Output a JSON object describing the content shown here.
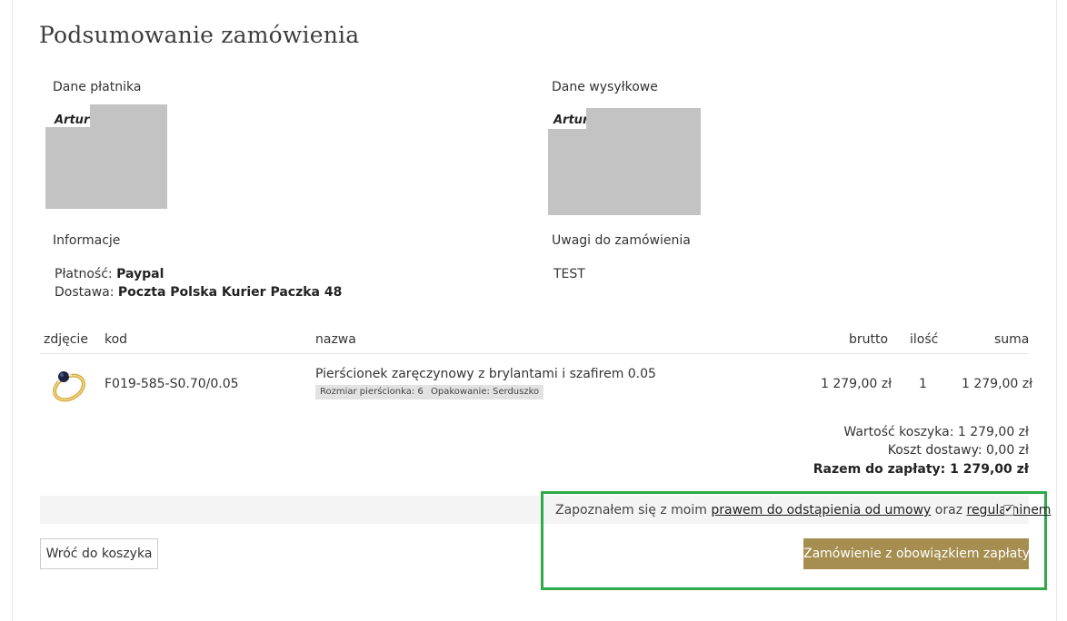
{
  "page": {
    "title": "Podsumowanie zamówienia"
  },
  "payer": {
    "label": "Dane płatnika",
    "name": "Artur"
  },
  "shipping": {
    "label": "Dane wysyłkowe",
    "name": "Artur"
  },
  "information": {
    "label": "Informacje",
    "payment_label": "Płatność:",
    "payment_value": "Paypal",
    "delivery_label": "Dostawa:",
    "delivery_value": "Poczta Polska Kurier Paczka 48"
  },
  "notes": {
    "label": "Uwagi do zamówienia",
    "value": "TEST"
  },
  "table": {
    "headers": {
      "photo": "zdjęcie",
      "code": "kod",
      "name": "nazwa",
      "gross": "brutto",
      "qty": "ilość",
      "total": "suma"
    },
    "rows": [
      {
        "code": "F019-585-S0.70/0.05",
        "name": "Pierścionek zaręczynowy z brylantami i szafirem 0.05",
        "tags": [
          "Rozmiar pierścionka: 6",
          "Opakowanie: Serduszko"
        ],
        "gross": "1 279,00 zł",
        "qty": "1",
        "total": "1 279,00 zł"
      }
    ]
  },
  "summary": {
    "cart_value": "Wartość koszyka: 1 279,00 zł",
    "delivery_cost": "Koszt dostawy: 0,00 zł",
    "total": "Razem do zapłaty: 1 279,00 zł"
  },
  "agreement": {
    "prefix": "Zapoznałem się z moim ",
    "link_withdrawal": "prawem do odstąpienia od umowy",
    "middle": " oraz ",
    "link_terms": "regulaminem",
    "checked": true
  },
  "buttons": {
    "back": "Wróć do koszyka",
    "order": "Zamówienie z obowiązkiem zapłaty."
  },
  "colors": {
    "accent_button": "#a58e4f",
    "highlight_border": "#2eaa4a",
    "redaction": "#c3c3c3"
  }
}
